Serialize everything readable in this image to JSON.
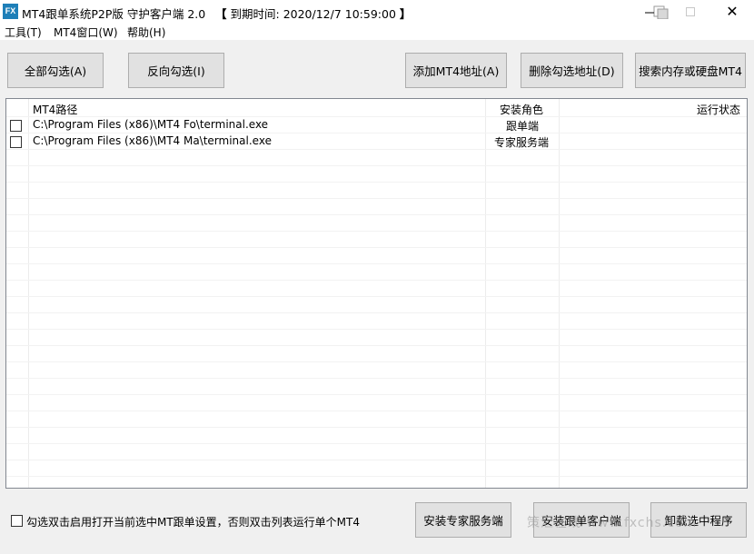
{
  "window": {
    "logo_text": "FX",
    "title": "MT4跟单系统P2P版 守护客户端 2.0",
    "expiry_open": "【",
    "expiry_label": "到期时间:",
    "expiry_value": "2020/12/7 10:59:00",
    "expiry_close": "】",
    "close_glyph": "✕"
  },
  "menu": {
    "items": [
      "工具(T)",
      "MT4窗口(W)",
      "帮助(H)"
    ]
  },
  "toolbar": {
    "select_all": "全部勾选(A)",
    "invert_select": "反向勾选(I)",
    "add_mt4": "添加MT4地址(A)",
    "delete_selected": "删除勾选地址(D)",
    "search_mt4": "搜索内存或硬盘MT4"
  },
  "table": {
    "columns": [
      "MT4路径",
      "安装角色",
      "运行状态"
    ],
    "rows": [
      {
        "checked": false,
        "path": "C:\\Program Files (x86)\\MT4 Fo\\terminal.exe",
        "role": "跟单端",
        "status": ""
      },
      {
        "checked": false,
        "path": "C:\\Program Files (x86)\\MT4 Ma\\terminal.exe",
        "role": "专家服务端",
        "status": ""
      }
    ]
  },
  "footer": {
    "checkbox_label": "勾选双击启用打开当前选中MT跟单设置，否则双击列表运行单个MT4",
    "install_expert": "安装专家服务端",
    "install_follower": "安装跟单客户端",
    "uninstall": "卸载选中程序"
  },
  "watermark": "策汇在线 www.fxchs.com",
  "colors": {
    "window_bg": "#f0f0f0",
    "button_bg": "#e1e1e1",
    "button_border": "#adadad",
    "logo_bg": "#1e7fb8"
  }
}
